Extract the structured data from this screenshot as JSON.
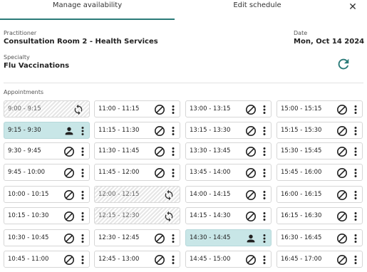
{
  "tabs": {
    "manage": "Manage availability",
    "edit": "Edit schedule"
  },
  "close_icon": "close-icon",
  "practitioner": {
    "label": "Practitioner",
    "value": "Consultation Room 2 - Health Services"
  },
  "date": {
    "label": "Date",
    "value": "Mon, Oct 14 2024"
  },
  "specialty": {
    "label": "Specialty",
    "value": "Flu Vaccinations"
  },
  "appointments_label": "Appointments",
  "colors": {
    "accent": "#2a7a78",
    "booked": "#c8e6e7"
  },
  "columns": [
    [
      {
        "time": "9:00 - 9:15",
        "state": "hatched"
      },
      {
        "time": "9:15 - 9:30",
        "state": "booked"
      },
      {
        "time": "9:30 - 9:45",
        "state": "blocked"
      },
      {
        "time": "9:45 - 10:00",
        "state": "blocked"
      },
      {
        "time": "10:00 - 10:15",
        "state": "blocked"
      },
      {
        "time": "10:15 - 10:30",
        "state": "blocked"
      },
      {
        "time": "10:30 - 10:45",
        "state": "blocked"
      },
      {
        "time": "10:45 - 11:00",
        "state": "blocked"
      }
    ],
    [
      {
        "time": "11:00 - 11:15",
        "state": "blocked"
      },
      {
        "time": "11:15 - 11:30",
        "state": "blocked"
      },
      {
        "time": "11:30 - 11:45",
        "state": "blocked"
      },
      {
        "time": "11:45 - 12:00",
        "state": "blocked"
      },
      {
        "time": "12:00 - 12:15",
        "state": "hatched"
      },
      {
        "time": "12:15 - 12:30",
        "state": "hatched"
      },
      {
        "time": "12:30 - 12:45",
        "state": "blocked"
      },
      {
        "time": "12:45 - 13:00",
        "state": "blocked"
      }
    ],
    [
      {
        "time": "13:00 - 13:15",
        "state": "blocked"
      },
      {
        "time": "13:15 - 13:30",
        "state": "blocked"
      },
      {
        "time": "13:30 - 13:45",
        "state": "blocked"
      },
      {
        "time": "13:45 - 14:00",
        "state": "blocked"
      },
      {
        "time": "14:00 - 14:15",
        "state": "blocked"
      },
      {
        "time": "14:15 - 14:30",
        "state": "blocked"
      },
      {
        "time": "14:30 - 14:45",
        "state": "booked"
      },
      {
        "time": "14:45 - 15:00",
        "state": "blocked"
      }
    ],
    [
      {
        "time": "15:00 - 15:15",
        "state": "blocked"
      },
      {
        "time": "15:15 - 15:30",
        "state": "blocked"
      },
      {
        "time": "15:30 - 15:45",
        "state": "blocked"
      },
      {
        "time": "15:45 - 16:00",
        "state": "blocked"
      },
      {
        "time": "16:00 - 16:15",
        "state": "blocked"
      },
      {
        "time": "16:15 - 16:30",
        "state": "blocked"
      },
      {
        "time": "16:30 - 16:45",
        "state": "blocked"
      },
      {
        "time": "16:45 - 17:00",
        "state": "blocked"
      }
    ]
  ]
}
